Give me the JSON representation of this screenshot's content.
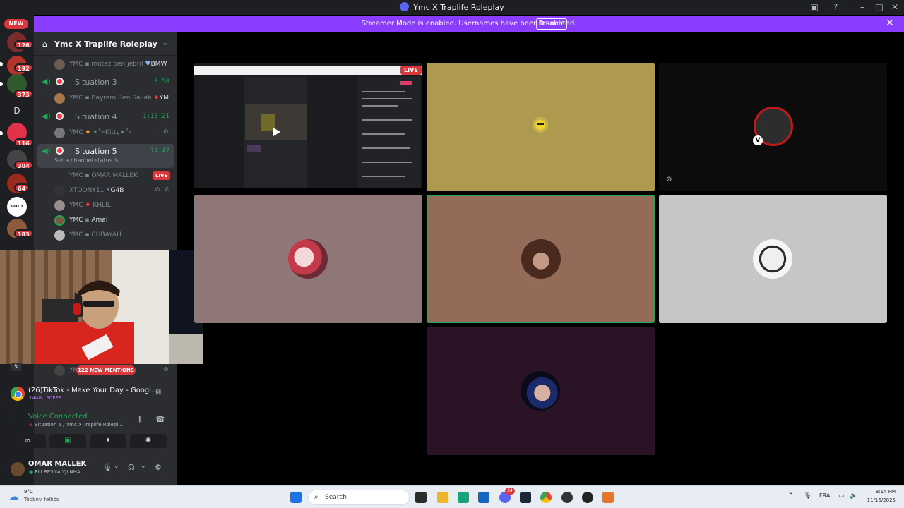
{
  "window": {
    "title": "Ymc X Traplife Roleplay"
  },
  "banner": {
    "message": "Streamer Mode is enabled. Usernames have been truncated.",
    "disable_label": "Disable"
  },
  "rail": {
    "new_badge": "NEW",
    "badges": [
      "126",
      "192",
      "373",
      "116",
      "304",
      "64",
      "183"
    ],
    "letter_server": "D",
    "goto_match": "GOTO MATCH"
  },
  "server": {
    "name": "Ymc X Traplife Roleplay"
  },
  "channels": {
    "top_user": {
      "prefix": "YMC",
      "name": "motaz ben jebril",
      "tag": "BMW"
    },
    "items": [
      {
        "name": "Situation 3",
        "timer": "8:58",
        "user": {
          "prefix": "YMC",
          "name": "Bayrem Ben Sallah",
          "tag": "YM"
        }
      },
      {
        "name": "Situation 4",
        "timer": "1:18:21",
        "user": {
          "prefix": "YMC",
          "name": "✴˚∘Kitty✴˚∘"
        }
      },
      {
        "name": "Situation 5",
        "timer": "14:47",
        "status": "Set a channel status"
      }
    ],
    "situation5_users": [
      {
        "prefix": "YMC",
        "name": "OMAR MALLEK",
        "live": "LIVE"
      },
      {
        "prefix": "",
        "name": "XTOONY11",
        "tag": "G4B"
      },
      {
        "prefix": "YMC",
        "name": "KHLIL"
      },
      {
        "prefix": "YMC",
        "name": "Amal"
      },
      {
        "prefix": "YMC",
        "name": "CHBAYAH"
      }
    ],
    "partial_user": "YM"
  },
  "mentions": "122 NEW MENTIONS",
  "activity": {
    "title": "(26)TikTok - Make Your Day - Googl...",
    "quality": "1440p 60FPS"
  },
  "voice": {
    "status": "Voice Connected",
    "location": "Situation 5 / Ymc X Traplife Rolepl..."
  },
  "user_panel": {
    "name": "OMAR MALLEK",
    "status": "ELI BE3NA YJI NHA..."
  },
  "grid": {
    "live_label": "LIVE"
  },
  "taskbar": {
    "temp": "9°C",
    "weather": "Többny. felhös",
    "search_placeholder": "Search",
    "discord_badge": "34",
    "lang": "FRA",
    "time": "8:14 PM",
    "date": "11/16/2025"
  },
  "colors": {
    "streamer_banner": "#8b3dff",
    "live_red": "#da373c",
    "voice_green": "#23a55a",
    "tile_gold": "#ad9a4f",
    "tile_rose": "#8f7778",
    "tile_brown": "#946a58",
    "tile_grey": "#c6c6c6",
    "tile_purple": "#2a1227"
  }
}
